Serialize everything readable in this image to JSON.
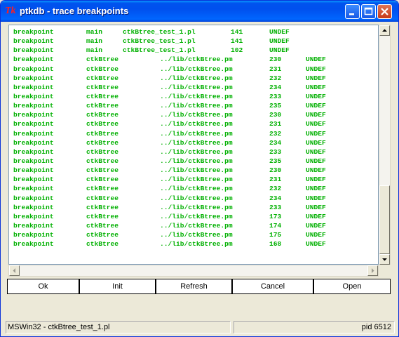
{
  "window": {
    "title": "ptkdb - trace breakpoints",
    "icon": "tk-icon",
    "colors": {
      "text": "#00b000",
      "title_bar": "#0053ee"
    }
  },
  "output": {
    "lines": [
      [
        "breakpoint",
        "main",
        "ctkBtree_test_1.pl",
        "141",
        "UNDEF"
      ],
      [
        "breakpoint",
        "main",
        "ctkBtree_test_1.pl",
        "141",
        "UNDEF"
      ],
      [
        "breakpoint",
        "main",
        "ctkBtree_test_1.pl",
        "102",
        "UNDEF"
      ],
      [
        "breakpoint",
        "ctkBtree",
        "../lib/ctkBtree.pm",
        "230",
        "UNDEF"
      ],
      [
        "breakpoint",
        "ctkBtree",
        "../lib/ctkBtree.pm",
        "231",
        "UNDEF"
      ],
      [
        "breakpoint",
        "ctkBtree",
        "../lib/ctkBtree.pm",
        "232",
        "UNDEF"
      ],
      [
        "breakpoint",
        "ctkBtree",
        "../lib/ctkBtree.pm",
        "234",
        "UNDEF"
      ],
      [
        "breakpoint",
        "ctkBtree",
        "../lib/ctkBtree.pm",
        "233",
        "UNDEF"
      ],
      [
        "breakpoint",
        "ctkBtree",
        "../lib/ctkBtree.pm",
        "235",
        "UNDEF"
      ],
      [
        "breakpoint",
        "ctkBtree",
        "../lib/ctkBtree.pm",
        "230",
        "UNDEF"
      ],
      [
        "breakpoint",
        "ctkBtree",
        "../lib/ctkBtree.pm",
        "231",
        "UNDEF"
      ],
      [
        "breakpoint",
        "ctkBtree",
        "../lib/ctkBtree.pm",
        "232",
        "UNDEF"
      ],
      [
        "breakpoint",
        "ctkBtree",
        "../lib/ctkBtree.pm",
        "234",
        "UNDEF"
      ],
      [
        "breakpoint",
        "ctkBtree",
        "../lib/ctkBtree.pm",
        "233",
        "UNDEF"
      ],
      [
        "breakpoint",
        "ctkBtree",
        "../lib/ctkBtree.pm",
        "235",
        "UNDEF"
      ],
      [
        "breakpoint",
        "ctkBtree",
        "../lib/ctkBtree.pm",
        "230",
        "UNDEF"
      ],
      [
        "breakpoint",
        "ctkBtree",
        "../lib/ctkBtree.pm",
        "231",
        "UNDEF"
      ],
      [
        "breakpoint",
        "ctkBtree",
        "../lib/ctkBtree.pm",
        "232",
        "UNDEF"
      ],
      [
        "breakpoint",
        "ctkBtree",
        "../lib/ctkBtree.pm",
        "234",
        "UNDEF"
      ],
      [
        "breakpoint",
        "ctkBtree",
        "../lib/ctkBtree.pm",
        "233",
        "UNDEF"
      ],
      [
        "breakpoint",
        "ctkBtree",
        "../lib/ctkBtree.pm",
        "173",
        "UNDEF"
      ],
      [
        "breakpoint",
        "ctkBtree",
        "../lib/ctkBtree.pm",
        "174",
        "UNDEF"
      ],
      [
        "breakpoint",
        "ctkBtree",
        "../lib/ctkBtree.pm",
        "175",
        "UNDEF"
      ],
      [
        "breakpoint",
        "ctkBtree",
        "../lib/ctkBtree.pm",
        "168",
        "UNDEF"
      ]
    ]
  },
  "buttons": {
    "ok": "Ok",
    "init": "Init",
    "refresh": "Refresh",
    "cancel": "Cancel",
    "open": "Open"
  },
  "status": {
    "left": "MSWin32 - ctkBtree_test_1.pl",
    "right": "pid 6512"
  }
}
